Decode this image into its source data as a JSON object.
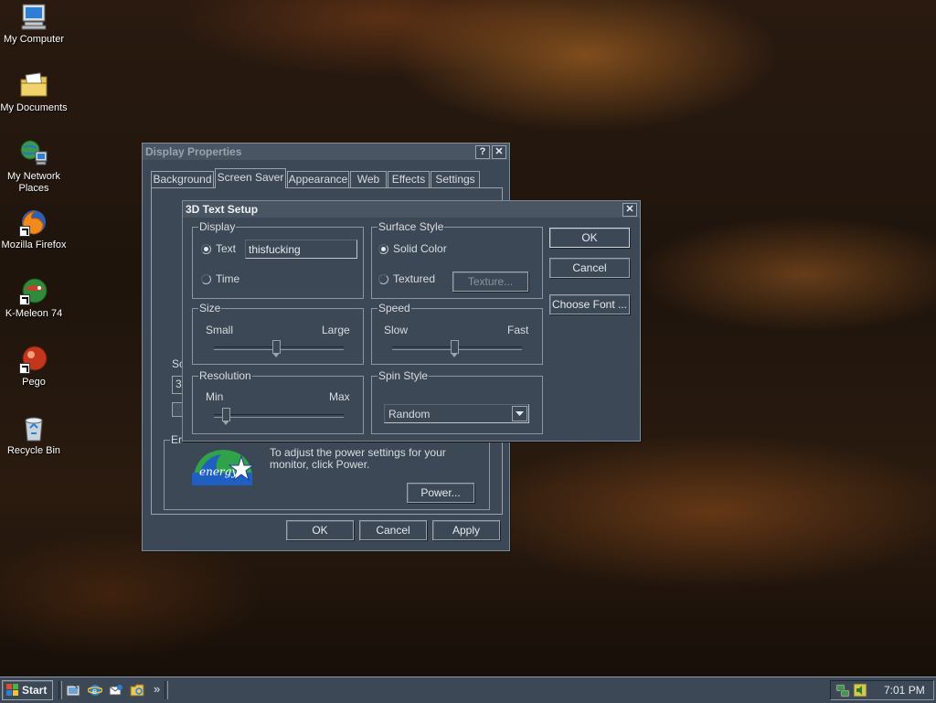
{
  "desktop": {
    "icons": [
      {
        "label": "My Computer",
        "icon": "my-computer-icon"
      },
      {
        "label": "My Documents",
        "icon": "my-documents-icon"
      },
      {
        "label": "My Network Places",
        "icon": "network-places-icon"
      },
      {
        "label": "Mozilla Firefox",
        "icon": "firefox-icon"
      },
      {
        "label": "K-Meleon 74",
        "icon": "k-meleon-icon"
      },
      {
        "label": "Pego",
        "icon": "pego-icon"
      },
      {
        "label": "Recycle Bin",
        "icon": "recycle-bin-icon"
      }
    ]
  },
  "display_properties": {
    "title": "Display Properties",
    "help_glyph": "?",
    "close_glyph": "✕",
    "tabs": [
      "Background",
      "Screen Saver",
      "Appearance",
      "Web",
      "Effects",
      "Settings"
    ],
    "active_tab": "Screen Saver",
    "screensaver_group_label": "Sc",
    "screensaver_value": "3l",
    "energy_group_label": "Er",
    "energy_star_text": "energy",
    "power_text": "To adjust the power settings for your monitor, click Power.",
    "power_button": "Power...",
    "ok": "OK",
    "cancel": "Cancel",
    "apply": "Apply"
  },
  "text3d_setup": {
    "title": "3D Text Setup",
    "close_glyph": "✕",
    "display": {
      "legend": "Display",
      "text_option": "Text",
      "text_value": "thisfucking",
      "time_option": "Time",
      "selected": "Text"
    },
    "surface": {
      "legend": "Surface Style",
      "solid_option": "Solid Color",
      "textured_option": "Textured",
      "texture_button": "Texture...",
      "selected": "Solid Color"
    },
    "size": {
      "legend": "Size",
      "min_label": "Small",
      "max_label": "Large",
      "level": 0.48
    },
    "speed": {
      "legend": "Speed",
      "min_label": "Slow",
      "max_label": "Fast",
      "level": 0.48
    },
    "resolution": {
      "legend": "Resolution",
      "min_label": "Min",
      "max_label": "Max",
      "level": 0.09
    },
    "spin": {
      "legend": "Spin Style",
      "value": "Random"
    },
    "ok": "OK",
    "cancel": "Cancel",
    "choose_font": "Choose Font ..."
  },
  "taskbar": {
    "start_label": "Start",
    "quicklaunch_more": "»",
    "clock": "7:01 PM"
  }
}
